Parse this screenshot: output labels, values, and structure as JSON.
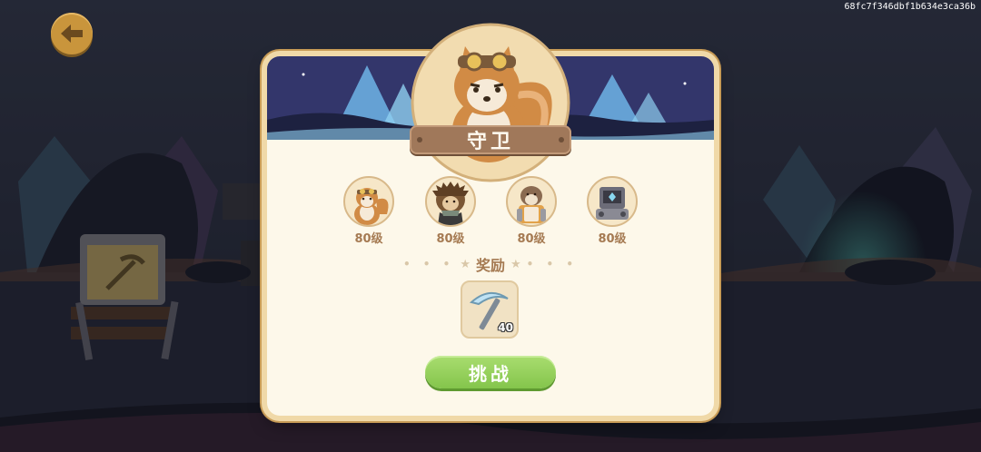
{
  "screen": {
    "id_text": "68fc7f346dbf1b634e3ca36b"
  },
  "nav": {
    "back_icon": "arrow-left-icon"
  },
  "dialog": {
    "title": "守卫",
    "portrait_icon": "squirrel-guard-icon",
    "enemies": [
      {
        "icon": "squirrel-goggles-icon",
        "level": "80级"
      },
      {
        "icon": "hedgehog-scarf-icon",
        "level": "80级"
      },
      {
        "icon": "beaver-armor-icon",
        "level": "80级"
      },
      {
        "icon": "robot-icon",
        "level": "80级"
      }
    ],
    "reward_label": "奖励",
    "reward": {
      "icon": "pickaxe-icon",
      "count": "40"
    },
    "challenge_label": "挑战"
  },
  "colors": {
    "accent_green": "#84c54c",
    "title_plate": "#a0785a",
    "dialog_bg": "#fdf8ea",
    "level_text": "#a57a52"
  }
}
